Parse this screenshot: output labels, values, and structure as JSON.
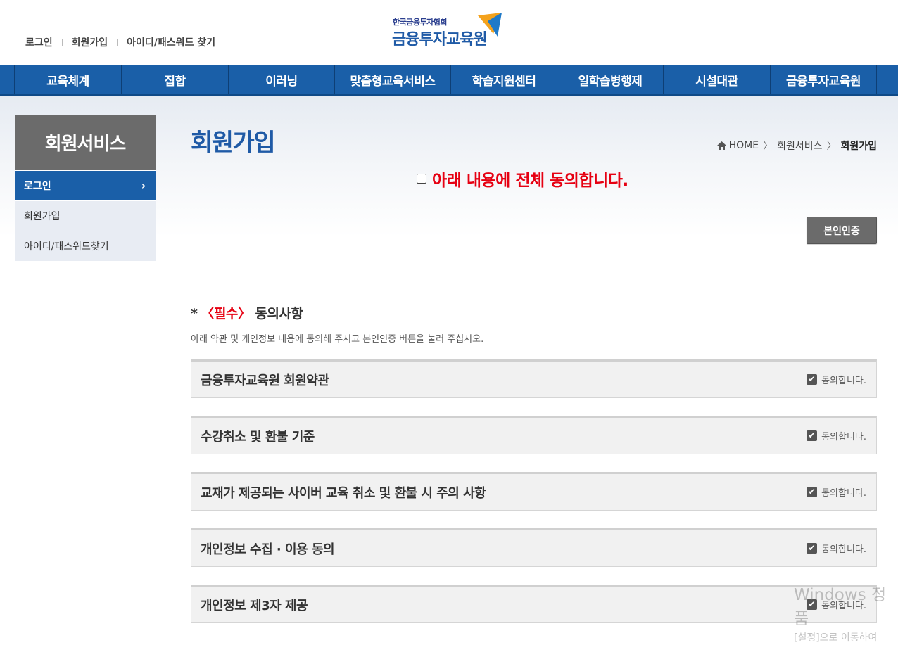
{
  "header": {
    "top_links": [
      "로그인",
      "회원가입",
      "아이디/패스워드 찾기"
    ],
    "logo_small": "한국금융투자협회",
    "logo_big": "금융투자교육원"
  },
  "nav": {
    "items": [
      {
        "label": "교육체계"
      },
      {
        "label": "집합"
      },
      {
        "label": "이러닝"
      },
      {
        "label": "맞춤형교육서비스"
      },
      {
        "label": "학습지원센터"
      },
      {
        "label": "일학습병행제"
      },
      {
        "label": "시설대관"
      },
      {
        "label": "금융투자교육원"
      }
    ]
  },
  "sidebar": {
    "title": "회원서비스",
    "items": [
      {
        "label": "로그인",
        "active": true
      },
      {
        "label": "회원가입",
        "active": false
      },
      {
        "label": "아이디/패스워드찾기",
        "active": false
      }
    ]
  },
  "main": {
    "title": "회원가입",
    "breadcrumb": [
      "HOME",
      "회원서비스",
      "회원가입"
    ],
    "agree_all": "아래 내용에 전체 동의합니다.",
    "verify_button": "본인인증",
    "required_star": "*",
    "required_tag": "〈필수〉",
    "required_title": "동의사항",
    "required_desc": "아래 약관 및 개인정보 내용에 동의해 주시고 본인인증 버튼을 눌러 주십시오.",
    "agree_label": "동의합니다.",
    "terms": [
      {
        "title": "금융투자교육원 회원약관",
        "checked": true
      },
      {
        "title": "수강취소 및 환불 기준",
        "checked": true
      },
      {
        "title": "교재가 제공되는 사이버 교육 취소 및 환불 시 주의 사항",
        "checked": true
      },
      {
        "title": "개인정보 수집 · 이용 동의",
        "checked": true
      },
      {
        "title": "개인정보 제3자 제공",
        "checked": true
      }
    ]
  },
  "watermark": {
    "line1": "Windows 정품",
    "line2": "[설정]으로 이동하여"
  },
  "colors": {
    "nav_bg": "#1a5fa8",
    "title": "#1f5aa6",
    "accent_red": "#e60012",
    "sidebar_head": "#6b6b6b"
  }
}
